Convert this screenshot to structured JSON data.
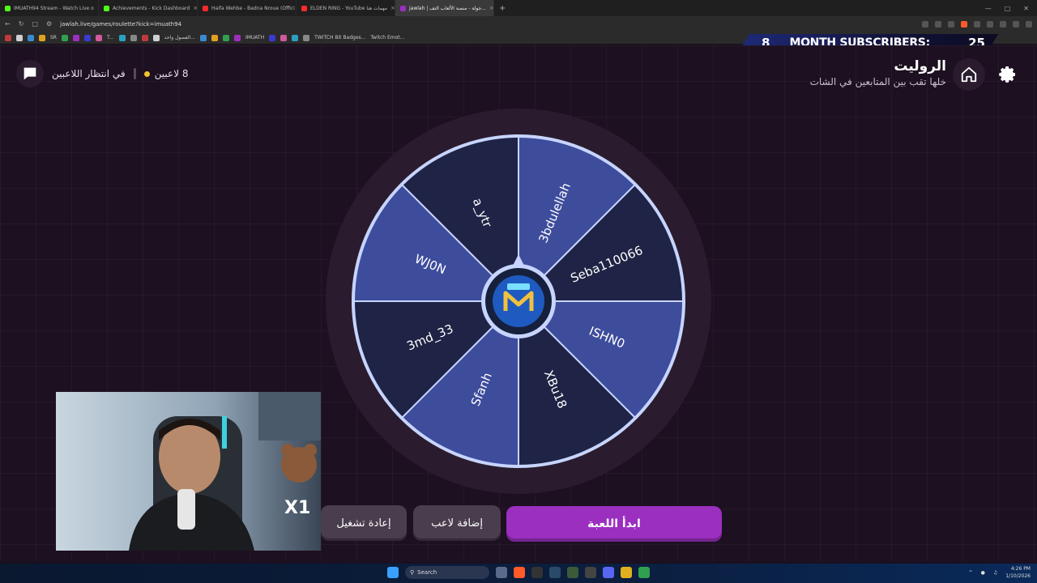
{
  "browser": {
    "tabs": [
      {
        "label": "IMUATH94 Stream - Watch Live o",
        "color": "#53fc18",
        "active": false
      },
      {
        "label": "Achievements - Kick Dashboard",
        "color": "#53fc18",
        "active": false
      },
      {
        "label": "Haifa Wehbe - Badna Nrouе (Offici",
        "color": "#ff2a2a",
        "active": false
      },
      {
        "label": "ELDEN RING - YouTube مهمات هنا",
        "color": "#ff2a2a",
        "active": false
      },
      {
        "label": "jawlah | جولة - منصة الألعاب التف...",
        "color": "#9b2fc0",
        "active": true
      }
    ],
    "url": "jawlah.live/games/roulette?kick=imuath94",
    "bookmarks": [
      "SR",
      "T...",
      "الفصول واحد...",
      "IMUATH",
      "TWITCH Bit Badges...",
      "Twitch Emot..."
    ]
  },
  "subscriber_banner": {
    "count": "8",
    "text": "MONTH SUBSCRIBERS:",
    "goal": "25"
  },
  "header": {
    "title": "الروليت",
    "subtitle": "خلها تقب بين المتابعين في الشات"
  },
  "status": {
    "players": "8 لاعبين",
    "waiting": "في انتظار اللاعبين"
  },
  "wheel": {
    "segments": [
      "3bdulellah",
      "Seba110066",
      "ISHN0",
      "XBu18",
      "Sfanh",
      "3md_33",
      "WJ0N",
      "a_ytr"
    ],
    "colors": {
      "light": "#3e4c9c",
      "dark": "#1f2446",
      "rim": "#2a1c2e",
      "border": "#c7d4ff"
    }
  },
  "buttons": {
    "start": "ابدأ اللعبة",
    "add_player": "إضافة لاعب",
    "reset": "إعادة تشغيل"
  },
  "overlay": {
    "multiplier": "X1"
  },
  "taskbar": {
    "search_placeholder": "Search",
    "time": "4:26 PM",
    "date": "1/10/2026"
  }
}
